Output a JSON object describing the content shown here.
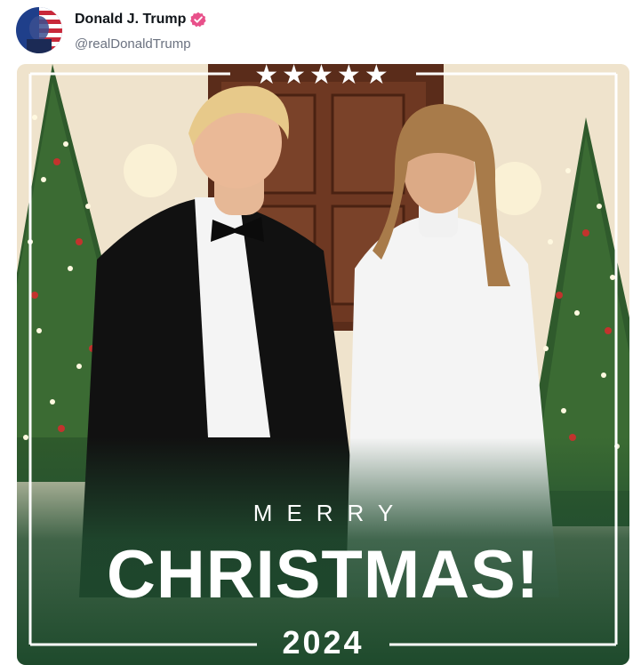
{
  "author": {
    "display_name": "Donald J. Trump",
    "handle": "@realDonaldTrump",
    "verified": true,
    "verified_badge_color": "#e8508a",
    "avatar_icon": "profile-avatar"
  },
  "image": {
    "stars": "★★★★★",
    "merry": "MERRY",
    "christmas": "CHRISTMAS!",
    "year": "2024",
    "accent_green": "#214d30"
  }
}
